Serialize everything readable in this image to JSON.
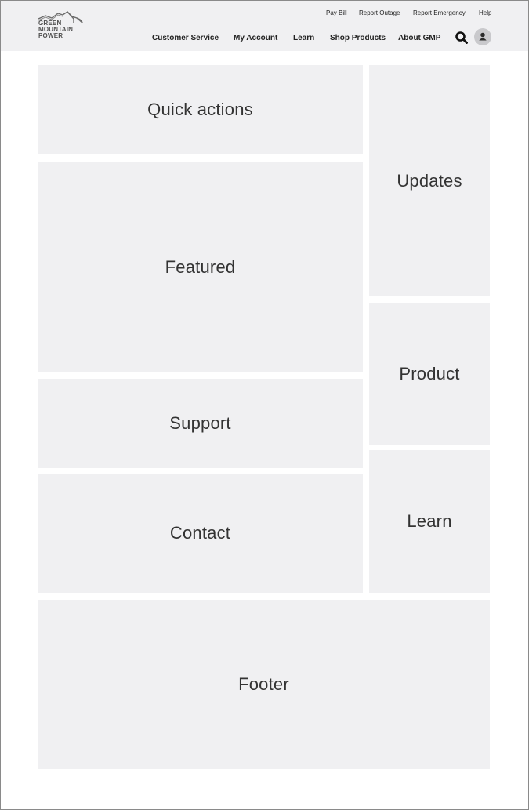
{
  "logo": {
    "lines": [
      "GREEN",
      "MOUNTAIN",
      "POWER"
    ]
  },
  "utility_nav": {
    "items": [
      {
        "label": "Pay Bill"
      },
      {
        "label": "Report Outage"
      },
      {
        "label": "Report Emergency"
      },
      {
        "label": "Help"
      }
    ]
  },
  "main_nav": {
    "items": [
      {
        "label": "Customer Service"
      },
      {
        "label": "My Account"
      },
      {
        "label": "Learn"
      },
      {
        "label": "Shop Products"
      },
      {
        "label": "About GMP"
      }
    ]
  },
  "icons": {
    "search": "search-icon",
    "account": "user-icon"
  },
  "blocks": {
    "quick_actions": "Quick actions",
    "featured": "Featured",
    "support": "Support",
    "contact": "Contact",
    "updates": "Updates",
    "product": "Product",
    "learn": "Learn",
    "footer": "Footer"
  },
  "colors": {
    "header_bg": "#f0f0f2",
    "block_bg": "#f0f0f2",
    "avatar_bg": "#c9c9cc"
  }
}
